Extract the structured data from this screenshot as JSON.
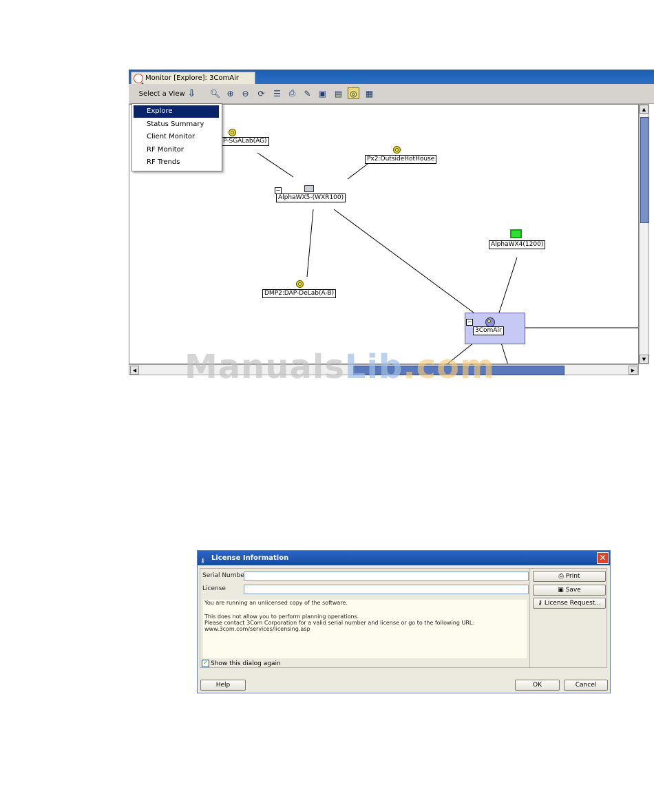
{
  "monitor": {
    "tab_title": "Monitor [Explore]: 3ComAir",
    "select_view_label": "Select a View",
    "toolbar_icons": [
      "search-icon",
      "zoom-in-icon",
      "zoom-out-icon",
      "refresh-icon",
      "list-icon",
      "print-icon",
      "annotate-icon",
      "network-icon",
      "device-icon",
      "ap-toggle-icon",
      "export-icon"
    ],
    "menu": {
      "items": [
        {
          "label": "Explore",
          "selected": true
        },
        {
          "label": "Status Summary",
          "selected": false
        },
        {
          "label": "Client Monitor",
          "selected": false
        },
        {
          "label": "RF Monitor",
          "selected": false
        },
        {
          "label": "RF Trends",
          "selected": false
        }
      ]
    },
    "nodes": {
      "ap1": "P-SGALab(AG)",
      "ap2": "Px2:OutsideHotHouse",
      "switch1": "AlphaWX5-(WXR100)",
      "switch2": "AlphaWX4(1200)",
      "ap3": "DMP2:DAP-DeLab(A-B)",
      "group": "3ComAir"
    }
  },
  "watermark": {
    "part1": "Manuals",
    "part2": "Lib",
    "part3": ".com"
  },
  "dialog": {
    "title": "License Information",
    "serial_label": "Serial Number",
    "serial_value": "",
    "license_label": "License",
    "license_value": "",
    "message_lines": [
      "You are running an unlicensed copy of the software.",
      "",
      "This does not allow you to perform planning operations.",
      "Please contact 3Com Corporation for a valid serial number and license or go to the following URL:",
      "www.3com.com/services/licensing.asp"
    ],
    "show_again_label": "Show this dialog again",
    "show_again_checked": true,
    "print_label": "Print",
    "save_label": "Save",
    "license_request_label": "License Request...",
    "help_label": "Help",
    "ok_label": "OK",
    "cancel_label": "Cancel"
  }
}
